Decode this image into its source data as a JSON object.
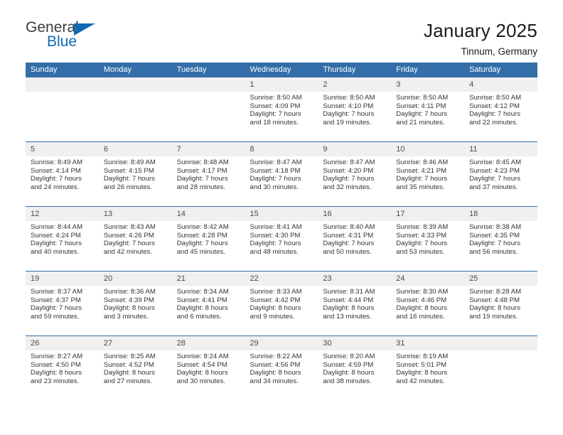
{
  "brand": {
    "name_part1": "General",
    "name_part2": "Blue",
    "accent_color": "#1268b3",
    "triangle_icon": "triangle-right-icon"
  },
  "header": {
    "title": "January 2025",
    "subtitle": "Tinnum, Germany",
    "header_bg_color": "#336ea9",
    "daynum_bg_color": "#f0f0f0"
  },
  "weekday_labels": [
    "Sunday",
    "Monday",
    "Tuesday",
    "Wednesday",
    "Thursday",
    "Friday",
    "Saturday"
  ],
  "labels": {
    "sunrise": "Sunrise:",
    "sunset": "Sunset:",
    "daylight": "Daylight:"
  },
  "weeks": [
    [
      {
        "day": "",
        "blank": true
      },
      {
        "day": "",
        "blank": true
      },
      {
        "day": "",
        "blank": true
      },
      {
        "day": "1",
        "sunrise": "Sunrise: 8:50 AM",
        "sunset": "Sunset: 4:09 PM",
        "daylight_1": "Daylight: 7 hours",
        "daylight_2": "and 18 minutes."
      },
      {
        "day": "2",
        "sunrise": "Sunrise: 8:50 AM",
        "sunset": "Sunset: 4:10 PM",
        "daylight_1": "Daylight: 7 hours",
        "daylight_2": "and 19 minutes."
      },
      {
        "day": "3",
        "sunrise": "Sunrise: 8:50 AM",
        "sunset": "Sunset: 4:11 PM",
        "daylight_1": "Daylight: 7 hours",
        "daylight_2": "and 21 minutes."
      },
      {
        "day": "4",
        "sunrise": "Sunrise: 8:50 AM",
        "sunset": "Sunset: 4:12 PM",
        "daylight_1": "Daylight: 7 hours",
        "daylight_2": "and 22 minutes."
      }
    ],
    [
      {
        "day": "5",
        "sunrise": "Sunrise: 8:49 AM",
        "sunset": "Sunset: 4:14 PM",
        "daylight_1": "Daylight: 7 hours",
        "daylight_2": "and 24 minutes."
      },
      {
        "day": "6",
        "sunrise": "Sunrise: 8:49 AM",
        "sunset": "Sunset: 4:15 PM",
        "daylight_1": "Daylight: 7 hours",
        "daylight_2": "and 26 minutes."
      },
      {
        "day": "7",
        "sunrise": "Sunrise: 8:48 AM",
        "sunset": "Sunset: 4:17 PM",
        "daylight_1": "Daylight: 7 hours",
        "daylight_2": "and 28 minutes."
      },
      {
        "day": "8",
        "sunrise": "Sunrise: 8:47 AM",
        "sunset": "Sunset: 4:18 PM",
        "daylight_1": "Daylight: 7 hours",
        "daylight_2": "and 30 minutes."
      },
      {
        "day": "9",
        "sunrise": "Sunrise: 8:47 AM",
        "sunset": "Sunset: 4:20 PM",
        "daylight_1": "Daylight: 7 hours",
        "daylight_2": "and 32 minutes."
      },
      {
        "day": "10",
        "sunrise": "Sunrise: 8:46 AM",
        "sunset": "Sunset: 4:21 PM",
        "daylight_1": "Daylight: 7 hours",
        "daylight_2": "and 35 minutes."
      },
      {
        "day": "11",
        "sunrise": "Sunrise: 8:45 AM",
        "sunset": "Sunset: 4:23 PM",
        "daylight_1": "Daylight: 7 hours",
        "daylight_2": "and 37 minutes."
      }
    ],
    [
      {
        "day": "12",
        "sunrise": "Sunrise: 8:44 AM",
        "sunset": "Sunset: 4:24 PM",
        "daylight_1": "Daylight: 7 hours",
        "daylight_2": "and 40 minutes."
      },
      {
        "day": "13",
        "sunrise": "Sunrise: 8:43 AM",
        "sunset": "Sunset: 4:26 PM",
        "daylight_1": "Daylight: 7 hours",
        "daylight_2": "and 42 minutes."
      },
      {
        "day": "14",
        "sunrise": "Sunrise: 8:42 AM",
        "sunset": "Sunset: 4:28 PM",
        "daylight_1": "Daylight: 7 hours",
        "daylight_2": "and 45 minutes."
      },
      {
        "day": "15",
        "sunrise": "Sunrise: 8:41 AM",
        "sunset": "Sunset: 4:30 PM",
        "daylight_1": "Daylight: 7 hours",
        "daylight_2": "and 48 minutes."
      },
      {
        "day": "16",
        "sunrise": "Sunrise: 8:40 AM",
        "sunset": "Sunset: 4:31 PM",
        "daylight_1": "Daylight: 7 hours",
        "daylight_2": "and 50 minutes."
      },
      {
        "day": "17",
        "sunrise": "Sunrise: 8:39 AM",
        "sunset": "Sunset: 4:33 PM",
        "daylight_1": "Daylight: 7 hours",
        "daylight_2": "and 53 minutes."
      },
      {
        "day": "18",
        "sunrise": "Sunrise: 8:38 AM",
        "sunset": "Sunset: 4:35 PM",
        "daylight_1": "Daylight: 7 hours",
        "daylight_2": "and 56 minutes."
      }
    ],
    [
      {
        "day": "19",
        "sunrise": "Sunrise: 8:37 AM",
        "sunset": "Sunset: 4:37 PM",
        "daylight_1": "Daylight: 7 hours",
        "daylight_2": "and 59 minutes."
      },
      {
        "day": "20",
        "sunrise": "Sunrise: 8:36 AM",
        "sunset": "Sunset: 4:39 PM",
        "daylight_1": "Daylight: 8 hours",
        "daylight_2": "and 3 minutes."
      },
      {
        "day": "21",
        "sunrise": "Sunrise: 8:34 AM",
        "sunset": "Sunset: 4:41 PM",
        "daylight_1": "Daylight: 8 hours",
        "daylight_2": "and 6 minutes."
      },
      {
        "day": "22",
        "sunrise": "Sunrise: 8:33 AM",
        "sunset": "Sunset: 4:42 PM",
        "daylight_1": "Daylight: 8 hours",
        "daylight_2": "and 9 minutes."
      },
      {
        "day": "23",
        "sunrise": "Sunrise: 8:31 AM",
        "sunset": "Sunset: 4:44 PM",
        "daylight_1": "Daylight: 8 hours",
        "daylight_2": "and 13 minutes."
      },
      {
        "day": "24",
        "sunrise": "Sunrise: 8:30 AM",
        "sunset": "Sunset: 4:46 PM",
        "daylight_1": "Daylight: 8 hours",
        "daylight_2": "and 16 minutes."
      },
      {
        "day": "25",
        "sunrise": "Sunrise: 8:28 AM",
        "sunset": "Sunset: 4:48 PM",
        "daylight_1": "Daylight: 8 hours",
        "daylight_2": "and 19 minutes."
      }
    ],
    [
      {
        "day": "26",
        "sunrise": "Sunrise: 8:27 AM",
        "sunset": "Sunset: 4:50 PM",
        "daylight_1": "Daylight: 8 hours",
        "daylight_2": "and 23 minutes."
      },
      {
        "day": "27",
        "sunrise": "Sunrise: 8:25 AM",
        "sunset": "Sunset: 4:52 PM",
        "daylight_1": "Daylight: 8 hours",
        "daylight_2": "and 27 minutes."
      },
      {
        "day": "28",
        "sunrise": "Sunrise: 8:24 AM",
        "sunset": "Sunset: 4:54 PM",
        "daylight_1": "Daylight: 8 hours",
        "daylight_2": "and 30 minutes."
      },
      {
        "day": "29",
        "sunrise": "Sunrise: 8:22 AM",
        "sunset": "Sunset: 4:56 PM",
        "daylight_1": "Daylight: 8 hours",
        "daylight_2": "and 34 minutes."
      },
      {
        "day": "30",
        "sunrise": "Sunrise: 8:20 AM",
        "sunset": "Sunset: 4:59 PM",
        "daylight_1": "Daylight: 8 hours",
        "daylight_2": "and 38 minutes."
      },
      {
        "day": "31",
        "sunrise": "Sunrise: 8:19 AM",
        "sunset": "Sunset: 5:01 PM",
        "daylight_1": "Daylight: 8 hours",
        "daylight_2": "and 42 minutes."
      },
      {
        "day": "",
        "blank": true
      }
    ]
  ]
}
